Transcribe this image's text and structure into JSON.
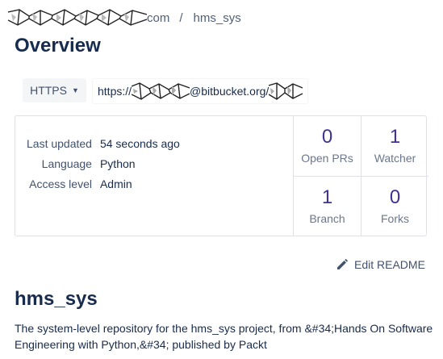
{
  "breadcrumb": {
    "workspace_suffix": "com",
    "separator": "/",
    "repo": "hms_sys"
  },
  "page_title": "Overview",
  "clone": {
    "protocol": "HTTPS",
    "url_prefix": "https://",
    "url_suffix": "@bitbucket.org/"
  },
  "details": {
    "last_updated_label": "Last updated",
    "last_updated_value": "54 seconds ago",
    "language_label": "Language",
    "language_value": "Python",
    "access_label": "Access level",
    "access_value": "Admin"
  },
  "stats": {
    "open_prs": {
      "value": "0",
      "label": "Open PRs"
    },
    "watchers": {
      "value": "1",
      "label": "Watcher"
    },
    "branches": {
      "value": "1",
      "label": "Branch"
    },
    "forks": {
      "value": "0",
      "label": "Forks"
    }
  },
  "readme": {
    "edit_label": "Edit README",
    "heading": "hms_sys",
    "description": "The system-level repository for the hms_sys project, from &#34;Hands On Software Engineering with Python,&#34; published by Packt"
  },
  "colors": {
    "accent": "#403294",
    "text": "#172b4d",
    "muted": "#6b778c",
    "border": "#dfe1e6"
  }
}
